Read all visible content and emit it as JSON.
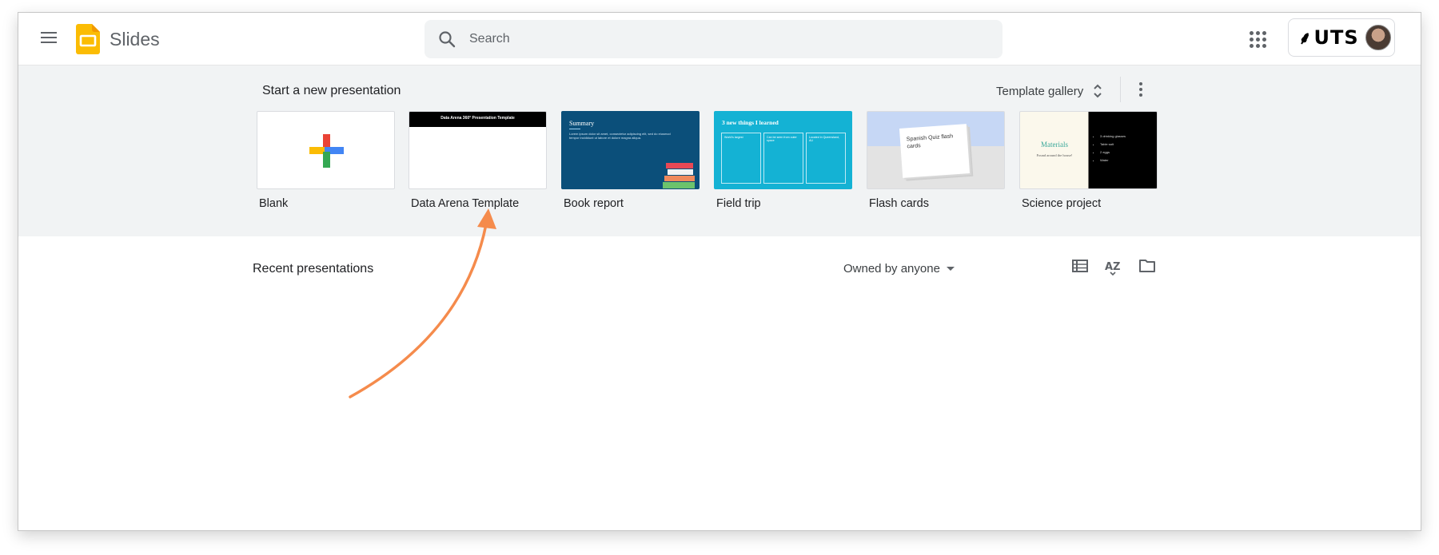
{
  "app": {
    "name": "Slides"
  },
  "search": {
    "placeholder": "Search"
  },
  "account": {
    "org": "UTS"
  },
  "templates": {
    "title": "Start a new presentation",
    "gallery_label": "Template gallery",
    "items": [
      {
        "label": "Blank"
      },
      {
        "label": "Data Arena Template",
        "thumb_text": "Data Arena 360° Presentation Template"
      },
      {
        "label": "Book report",
        "thumb_title": "Summary",
        "thumb_body": "Lorem ipsum dolor sit amet, consectetur adipiscing elit, sed do eiusmod tempor incididunt ut labore et dolore magna aliqua."
      },
      {
        "label": "Field trip",
        "thumb_title": "3 new things I learned",
        "columns": [
          "World's largest",
          "Can be seen from outer space",
          "Located in Queensland, AU"
        ]
      },
      {
        "label": "Flash cards",
        "thumb_title": "Spanish Quiz flash cards"
      },
      {
        "label": "Science project",
        "thumb_title": "Materials",
        "thumb_sub": "Found around the house!",
        "list": [
          "3 drinking glasses",
          "Table salt",
          "2 eggs",
          "Water"
        ]
      }
    ]
  },
  "recent": {
    "title": "Recent presentations",
    "owner_filter": "Owned by anyone"
  },
  "colors": {
    "accent_arrow": "#f58b4c",
    "slides_yellow": "#fbbc04",
    "book_blue": "#0b4f7a",
    "field_cyan": "#14b2d4"
  },
  "icons": [
    "menu-icon",
    "slides-logo-icon",
    "search-icon",
    "apps-grid-icon",
    "more-vert-icon",
    "list-view-icon",
    "sort-az-icon",
    "folder-icon"
  ]
}
